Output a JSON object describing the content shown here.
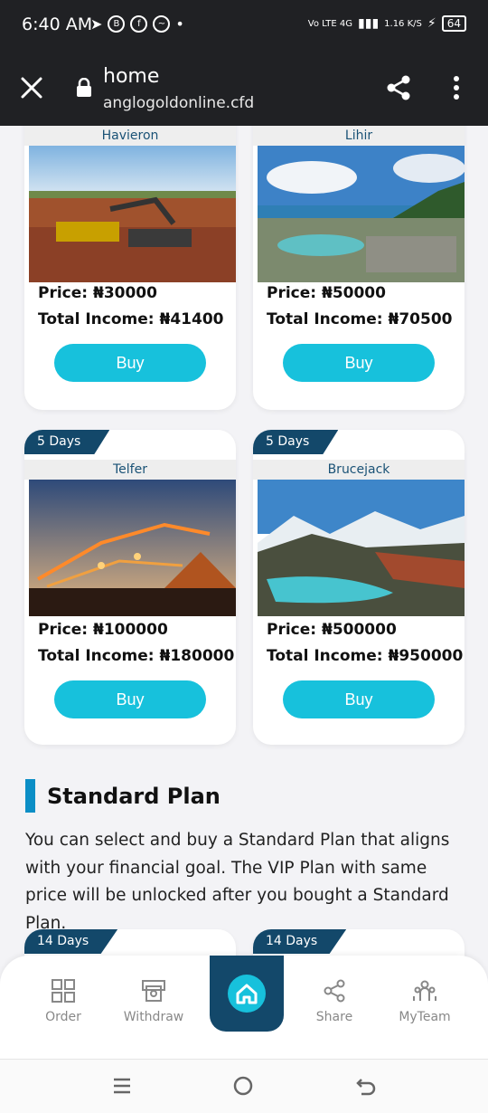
{
  "status_bar": {
    "time": "6:40 AM",
    "network": "Vo LTE 4G",
    "speed": "1.16 K/S",
    "battery": "64"
  },
  "browser": {
    "page_title": "home",
    "domain": "anglogoldonline.cfd"
  },
  "products_top": [
    {
      "name": "Havieron",
      "price": "Price: ₦30000",
      "income": "Total Income: ₦41400",
      "buy_label": "Buy"
    },
    {
      "name": "Lihir",
      "price": "Price: ₦50000",
      "income": "Total Income: ₦70500",
      "buy_label": "Buy"
    }
  ],
  "products_mid": [
    {
      "days": "5 Days",
      "name": "Telfer",
      "price": "Price: ₦100000",
      "income": "Total Income: ₦180000",
      "buy_label": "Buy"
    },
    {
      "days": "5 Days",
      "name": "Brucejack",
      "price": "Price: ₦500000",
      "income": "Total Income: ₦950000",
      "buy_label": "Buy"
    }
  ],
  "standard_plan": {
    "title": "Standard Plan",
    "description": "You can select and buy a Standard Plan that aligns with your financial goal. The VIP Plan with same price will be unlocked after you bought a Standard Plan."
  },
  "products_bottom": [
    {
      "days": "14 Days"
    },
    {
      "days": "14 Days"
    }
  ],
  "bottom_nav": {
    "order": "Order",
    "withdraw": "Withdraw",
    "share": "Share",
    "myteam": "MyTeam"
  },
  "colors": {
    "accent": "#17c1dc",
    "navy": "#13486a",
    "section_bar": "#0b8ec6"
  }
}
